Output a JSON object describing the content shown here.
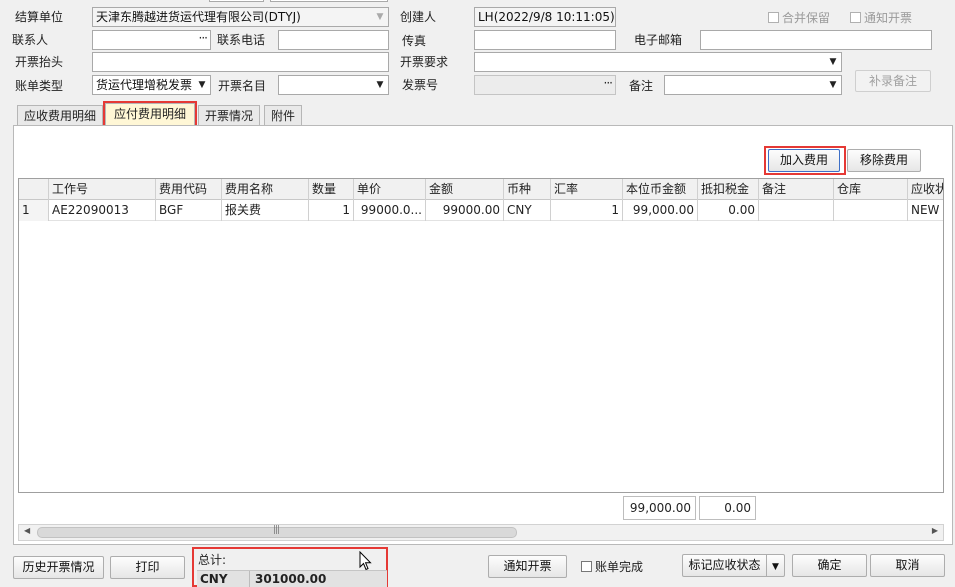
{
  "header": {
    "settle_unit_label": "结算单位",
    "settle_unit_value": "天津东腾越进货运代理有限公司(DTYJ)",
    "creator_label": "创建人",
    "creator_value": "LH(2022/9/8 10:11:05)",
    "merge_keep_label": "合并保留",
    "notify_invoice_check_label": "通知开票",
    "contact_label": "联系人",
    "contact_phone_label": "联系电话",
    "fax_label": "传真",
    "email_label": "电子邮箱",
    "invoice_title_label": "开票抬头",
    "invoice_req_label": "开票要求",
    "bill_type_label": "账单类型",
    "bill_type_value": "货运代理增税发票",
    "invoice_item_label": "开票名目",
    "invoice_no_label": "发票号",
    "remark_label": "备注",
    "add_remark_button": "补录备注"
  },
  "tabs": [
    "应收费用明细",
    "应付费用明细",
    "开票情况",
    "附件"
  ],
  "actions": {
    "add_fee": "加入费用",
    "remove_fee": "移除费用"
  },
  "grid": {
    "columns": [
      "",
      "工作号",
      "费用代码",
      "费用名称",
      "数量",
      "单价",
      "金额",
      "币种",
      "汇率",
      "本位币金额",
      "抵扣税金",
      "备注",
      "仓库",
      "应收状"
    ],
    "rows": [
      [
        "1",
        "AE22090013",
        "BGF",
        "报关费",
        "1",
        "99000.0...",
        "99000.00",
        "CNY",
        "1",
        "99,000.00",
        "0.00",
        "",
        "",
        "NEW"
      ]
    ],
    "footer_base_amount": "99,000.00",
    "footer_tax": "0.00"
  },
  "bottom": {
    "history_invoice": "历史开票情况",
    "print": "打印",
    "total_label": "总计:",
    "total_currency": "CNY",
    "total_amount": "301000.00",
    "notify_invoice": "通知开票",
    "bill_done_label": "账单完成",
    "mark_status": "标记应收状态",
    "confirm": "确定",
    "cancel": "取消"
  }
}
